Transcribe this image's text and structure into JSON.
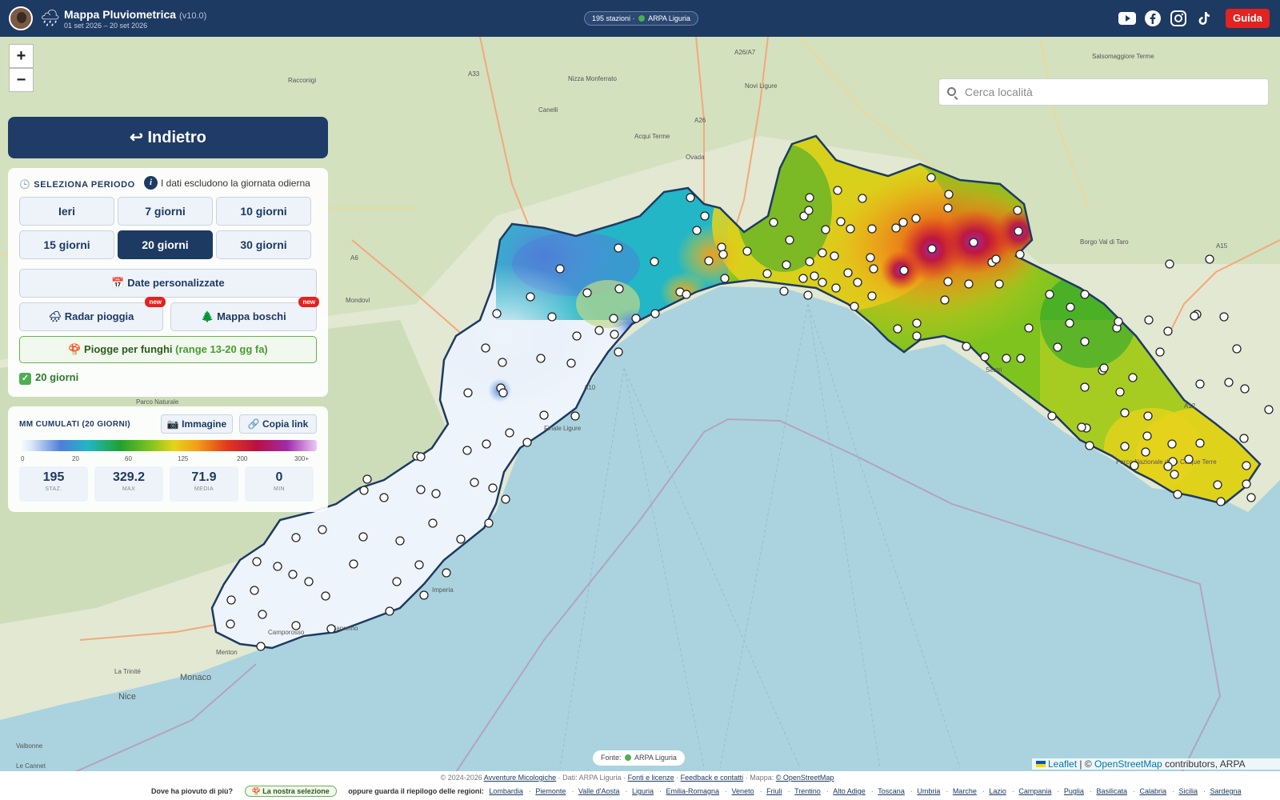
{
  "header": {
    "title": "Mappa Pluviometrica",
    "version": "(v10.0)",
    "dates": "01 set 2026 – 20 set 2026",
    "stations_pill": "195 stazioni ·",
    "source_pill": "ARPA Liguria",
    "guide_label": "Guida",
    "social_icons": [
      "youtube-icon",
      "facebook-icon",
      "instagram-icon",
      "tiktok-icon"
    ]
  },
  "map": {
    "zoom_in": "+",
    "zoom_out": "−",
    "search_placeholder": "Cerca località",
    "labels": [
      {
        "text": "A26/A7"
      },
      {
        "text": "Nizza Monferrato"
      },
      {
        "text": "A33"
      },
      {
        "text": "Racconigi"
      },
      {
        "text": "Canelli"
      },
      {
        "text": "A26"
      },
      {
        "text": "Acqui Terme"
      },
      {
        "text": "Ovada"
      },
      {
        "text": "Novi Ligure"
      },
      {
        "text": "A6"
      },
      {
        "text": "Mondovì"
      },
      {
        "text": "Salsomaggiore Terme"
      },
      {
        "text": "Borgo Val di Taro"
      },
      {
        "text": "A15"
      },
      {
        "text": "Parco Naturale"
      },
      {
        "text": "Finale Ligure"
      },
      {
        "text": "A10"
      },
      {
        "text": "Imperia"
      },
      {
        "text": "Camporosso"
      },
      {
        "text": "Sanremo"
      },
      {
        "text": "Menton"
      },
      {
        "text": "Monaco"
      },
      {
        "text": "Nice"
      },
      {
        "text": "La Trinité"
      },
      {
        "text": "Sestri"
      },
      {
        "text": "A12"
      },
      {
        "text": "Parco Nazionale delle Cinque Terre"
      },
      {
        "text": "Le Cannet"
      },
      {
        "text": "Valbonne"
      }
    ]
  },
  "back_label": "↩ Indietro",
  "period": {
    "title": "SELEZIONA PERIODO",
    "info": "I dati escludono la giornata odierna",
    "options": [
      "Ieri",
      "7 giorni",
      "10 giorni",
      "15 giorni",
      "20 giorni",
      "30 giorni"
    ],
    "selected": "20 giorni",
    "custom_dates": "Date personalizzate",
    "radar": "Radar pioggia",
    "woods": "Mappa boschi",
    "new_badge": "new",
    "funghi": "Piogge per funghi",
    "funghi_range": "(range 13-20 gg fa)",
    "selection": "20 giorni"
  },
  "legend": {
    "title": "MM CUMULATI (20 GIORNI)",
    "image_button": "Immagine",
    "link_button": "Copia link",
    "ticks": [
      "0",
      "20",
      "60",
      "125",
      "200",
      "300+"
    ],
    "stats": [
      {
        "value": "195",
        "label": "STAZ."
      },
      {
        "value": "329.2",
        "label": "MAX"
      },
      {
        "value": "71.9",
        "label": "MEDIA"
      },
      {
        "value": "0",
        "label": "MIN"
      }
    ]
  },
  "source_badge": "Fonte:",
  "source_name": "ARPA Liguria",
  "attribution": {
    "leaflet": "Leaflet",
    "sep": "| ©",
    "osm": "OpenStreetMap",
    "rest": "contributors, ARPA Liguria"
  },
  "footer": {
    "copyright": "© 2024-2026",
    "site": "Avventure Micologiche",
    "data": "· Dati: ARPA Liguria ·",
    "sources": "Fonti e licenze",
    "dot1": "·",
    "feedback": "Feedback e contatti",
    "map": "· Mappa:",
    "osm": "© OpenStreetMap",
    "question": "Dove ha piovuto di più?",
    "our_selection": "La nostra selezione",
    "or_text": "oppure guarda il riepilogo delle regioni:",
    "regions": [
      "Lombardia",
      "Piemonte",
      "Valle d'Aosta",
      "Liguria",
      "Emilia-Romagna",
      "Veneto",
      "Friuli",
      "Trentino",
      "Alto Adige",
      "Toscana",
      "Umbria",
      "Marche",
      "Lazio",
      "Campania",
      "Puglia",
      "Basilicata",
      "Calabria",
      "Sicilia",
      "Sardegna"
    ]
  }
}
